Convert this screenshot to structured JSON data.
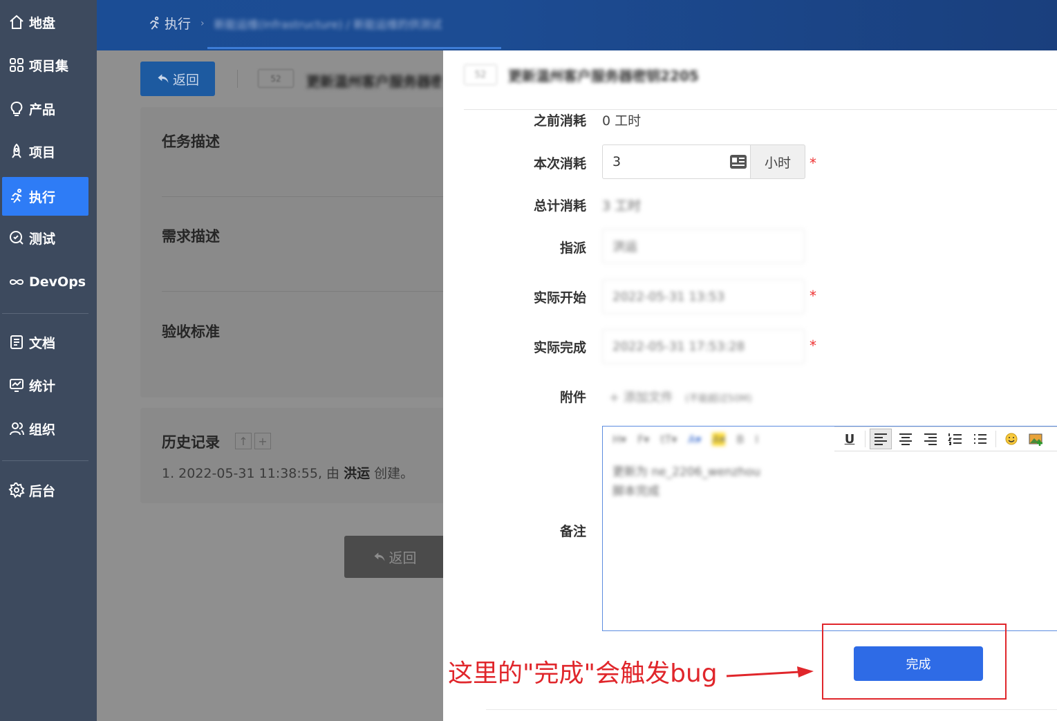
{
  "sidebar": {
    "items": [
      {
        "label": "地盘",
        "icon": "home-icon"
      },
      {
        "label": "项目集",
        "icon": "grid-icon"
      },
      {
        "label": "产品",
        "icon": "lightbulb-icon"
      },
      {
        "label": "项目",
        "icon": "rocket-icon"
      },
      {
        "label": "执行",
        "icon": "run-icon",
        "active": true
      },
      {
        "label": "测试",
        "icon": "test-icon"
      },
      {
        "label": "DevOps",
        "icon": "infinity-icon"
      },
      {
        "label": "文档",
        "icon": "document-icon"
      },
      {
        "label": "统计",
        "icon": "chart-icon"
      },
      {
        "label": "组织",
        "icon": "people-icon"
      },
      {
        "label": "后台",
        "icon": "gear-icon"
      }
    ]
  },
  "header": {
    "crumb_label": "执行",
    "crumb_path": "新能运维(Infrastructure) / 新能运维的供测试"
  },
  "left": {
    "back_label": "返回",
    "task_id": "52",
    "task_title": "更新温州客户服务器密钥",
    "sections": [
      "任务描述",
      "需求描述",
      "验收标准"
    ],
    "history_title": "历史记录",
    "history_prefix": "1. 2022-05-31 11:38:55, 由 ",
    "history_user": "洪运",
    "history_suffix": " 创建。",
    "bottom_back_label": "返回"
  },
  "modal": {
    "task_id": "52",
    "title": "更新温州客户服务器密钥2205",
    "fields": {
      "before_label": "之前消耗",
      "before_value": "0 工时",
      "current_label": "本次消耗",
      "current_value": "3",
      "current_unit": "小时",
      "total_label": "总计消耗",
      "total_value": "3 工时",
      "assign_label": "指派",
      "assign_value": "洪运",
      "start_label": "实际开始",
      "start_value": "2022-05-31 13:53",
      "finish_label": "实际完成",
      "finish_value": "2022-05-31 17:53:28",
      "attach_label": "附件",
      "attach_action": "添加文件",
      "attach_hint": "(不能超过50M)",
      "note_label": "备注",
      "note_line1": "更新为 ne_2206_wenzhou",
      "note_line2": "脚本完成"
    },
    "submit_label": "完成"
  },
  "annotation": {
    "text": "这里的\"完成\"会触发bug",
    "color": "#e0262b"
  },
  "colors": {
    "accent": "#2e6be6",
    "sidebar_bg": "#3d4a5e",
    "header_bg": "#1b4d95"
  }
}
